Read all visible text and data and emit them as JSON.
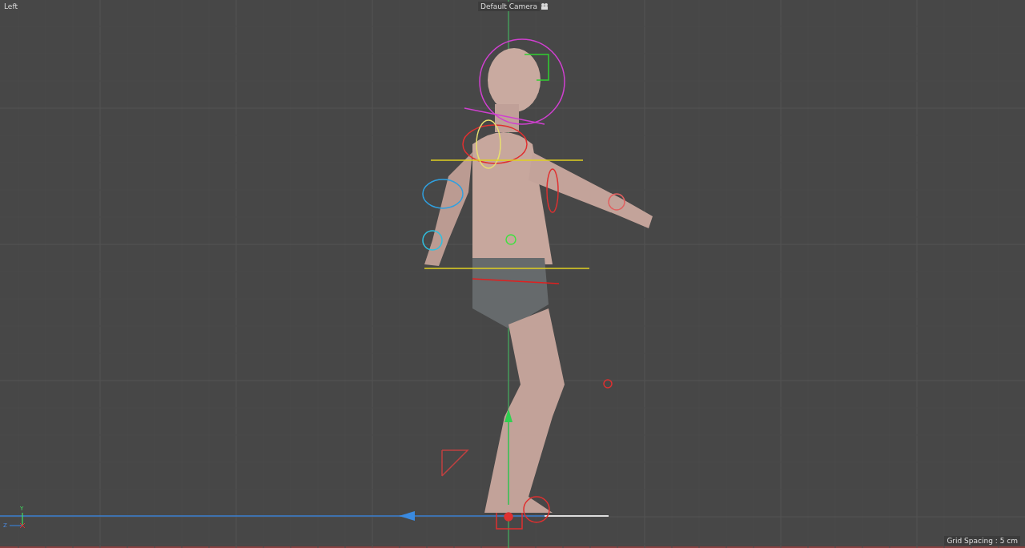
{
  "viewport": {
    "view_name": "Left",
    "camera": "Default Camera",
    "grid_spacing": "Grid Spacing : 5 cm",
    "axis_labels": [
      "Y",
      "Z"
    ]
  }
}
